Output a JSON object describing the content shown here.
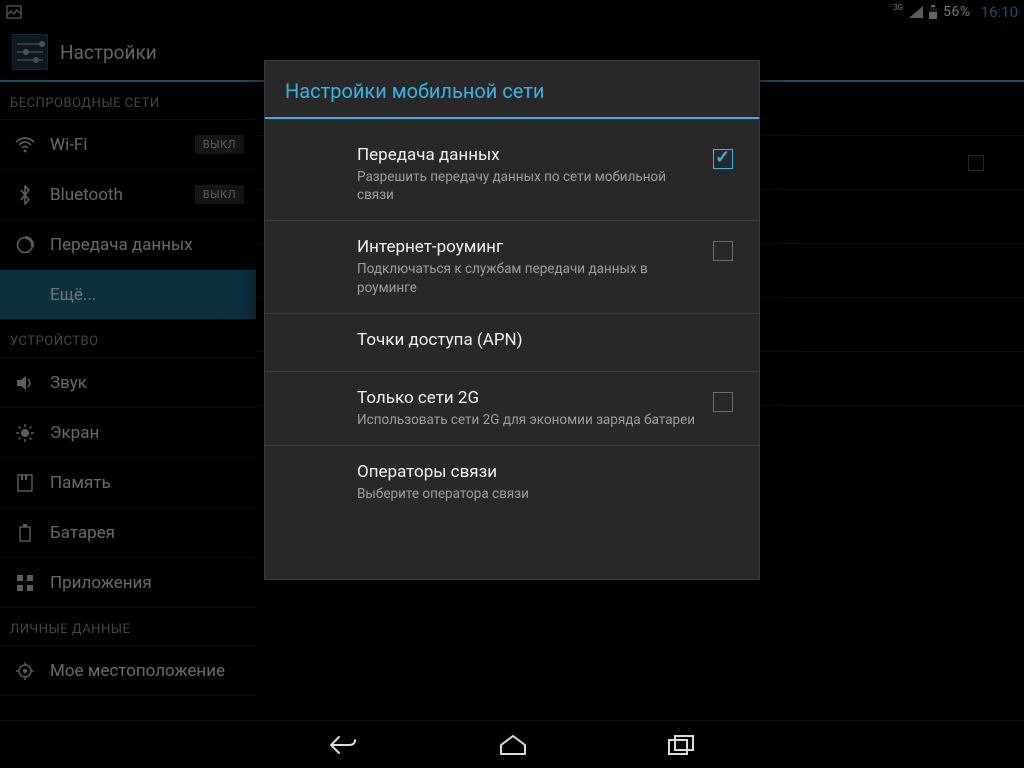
{
  "statusbar": {
    "network_type": "3G",
    "battery": "56%",
    "time": "16:10"
  },
  "actionbar": {
    "title": "Настройки"
  },
  "sidebar": {
    "headers": {
      "wireless": "БЕСПРОВОДНЫЕ СЕТИ",
      "device": "УСТРОЙСТВО",
      "personal": "ЛИЧНЫЕ ДАННЫЕ"
    },
    "items": {
      "wifi": {
        "label": "Wi-Fi",
        "switch": "ВЫКЛ"
      },
      "bluetooth": {
        "label": "Bluetooth",
        "switch": "ВЫКЛ"
      },
      "data_usage": {
        "label": "Передача данных"
      },
      "more": {
        "label": "Ещё..."
      },
      "sound": {
        "label": "Звук"
      },
      "display": {
        "label": "Экран"
      },
      "storage": {
        "label": "Память"
      },
      "battery": {
        "label": "Батарея"
      },
      "apps": {
        "label": "Приложения"
      },
      "location": {
        "label": "Мое местоположение"
      }
    }
  },
  "dialog": {
    "title": "Настройки мобильной сети",
    "items": [
      {
        "label": "Передача данных",
        "summary": "Разрешить передачу данных по сети мобильной связи",
        "checked": true
      },
      {
        "label": "Интернет-роуминг",
        "summary": "Подключаться к службам передачи данных в роуминге",
        "checked": false
      },
      {
        "label": "Точки доступа (APN)"
      },
      {
        "label": "Только сети 2G",
        "summary": "Использовать сети 2G для экономии заряда батареи",
        "checked": false
      },
      {
        "label": "Операторы связи",
        "summary": "Выберите оператора связи"
      }
    ]
  }
}
